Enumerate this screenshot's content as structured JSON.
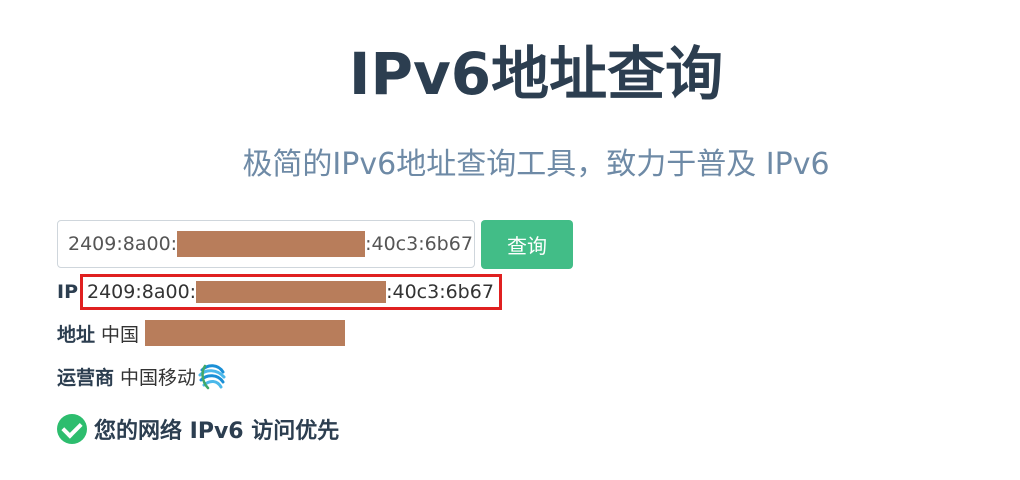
{
  "header": {
    "title": "IPv6地址查询",
    "subtitle": "极简的IPv6地址查询工具，致力于普及 IPv6"
  },
  "query": {
    "input_prefix": "2409:8a00:",
    "input_suffix": ":40c3:6b67",
    "button_label": "查询"
  },
  "result": {
    "ip_label": "IP",
    "ip_prefix": "2409:8a00:",
    "ip_suffix": ":40c3:6b67",
    "address_label": "地址",
    "address_value": "中国",
    "isp_label": "运营商",
    "isp_value": "中国移动",
    "isp_icon": "china-mobile-logo-icon"
  },
  "status": {
    "icon": "check-circle-icon",
    "text": "您的网络 IPv6 访问优先"
  },
  "colors": {
    "title": "#2c3e50",
    "subtitle": "#6e8aa6",
    "button": "#42bd87",
    "redaction": "#b87d5b",
    "highlight_border": "#e02020",
    "check": "#2dbd6e"
  }
}
